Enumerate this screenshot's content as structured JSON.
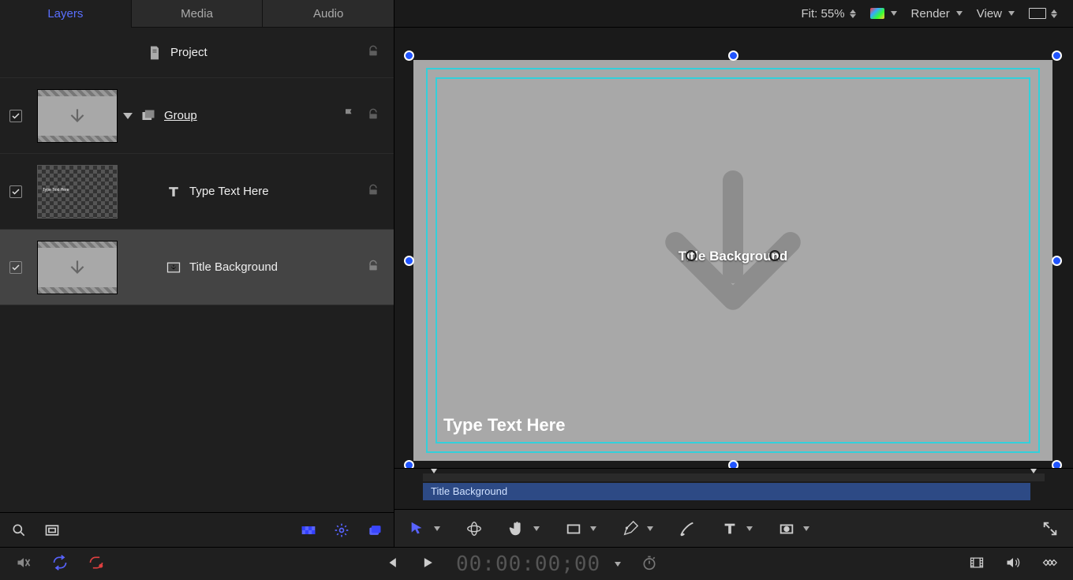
{
  "tabs": {
    "layers": "Layers",
    "media": "Media",
    "audio": "Audio"
  },
  "layers": {
    "project": "Project",
    "group": "Group",
    "text": "Type Text Here",
    "titlebg": "Title Background"
  },
  "canvas": {
    "fit_label": "Fit: 55%",
    "render": "Render",
    "view": "View",
    "caption": "Title Background",
    "bottom_text": "Type Text Here"
  },
  "mini_timeline": {
    "clip": "Title Background"
  },
  "transport": {
    "timecode": "00:00:00;00"
  }
}
